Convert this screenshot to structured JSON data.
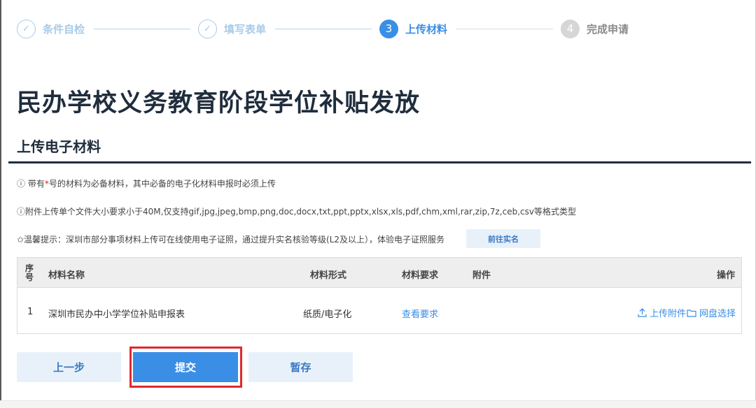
{
  "steps": [
    {
      "num": "✓",
      "label": "条件自检",
      "state": "done"
    },
    {
      "num": "✓",
      "label": "填写表单",
      "state": "done"
    },
    {
      "num": "3",
      "label": "上传材料",
      "state": "active"
    },
    {
      "num": "4",
      "label": "完成申请",
      "state": "todo"
    }
  ],
  "page_title": "民办学校义务教育阶段学位补贴发放",
  "section_title": "上传电子材料",
  "notes": {
    "required_prefix": "ⓘ 带有",
    "required_star": "*",
    "required_suffix": "号的材料为必备材料，其中必备的电子化材料申报时必须上传",
    "formats": "ⓘ附件上传单个文件大小要求小于40M,仅支持gif,jpg,jpeg,bmp,png,doc,docx,txt,ppt,pptx,xlsx,xls,pdf,chm,xml,rar,zip,7z,ceb,csv等格式类型",
    "tip": "✩温馨提示：深圳市部分事项材料上传可在线使用电子证照，通过提升实名核验等级(L2及以上），体验电子证照服务",
    "goto_label": "前往实名"
  },
  "table": {
    "headers": {
      "seq": "序号",
      "name": "材料名称",
      "form": "材料形式",
      "req": "材料要求",
      "attach": "附件",
      "op": "操作"
    },
    "rows": [
      {
        "seq": "1",
        "name": "深圳市民办中小学学位补贴申报表",
        "form": "纸质/电子化",
        "req": "查看要求",
        "upload": "上传附件",
        "disk": "网盘选择"
      }
    ]
  },
  "buttons": {
    "prev": "上一步",
    "submit": "提交",
    "save": "暂存"
  },
  "colors": {
    "accent": "#3a8ee6",
    "highlight": "#e0292f",
    "title": "#1f2d3d"
  }
}
